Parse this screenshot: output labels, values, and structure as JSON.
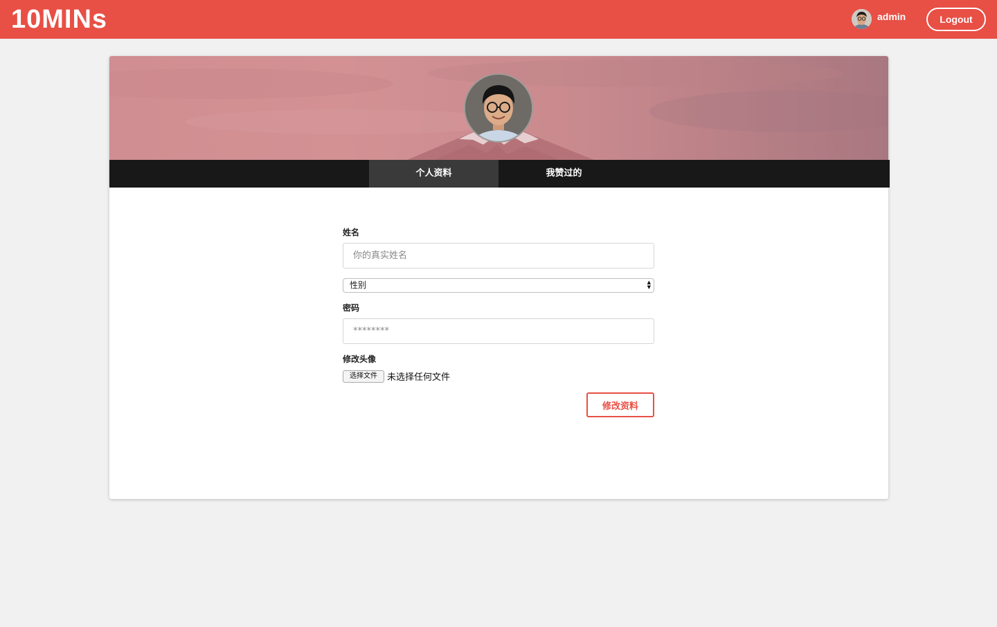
{
  "header": {
    "brand": "10MINs",
    "username": "admin",
    "logout_label": "Logout"
  },
  "profile": {
    "tabs": [
      {
        "label": "个人资料",
        "active": true
      },
      {
        "label": "我赞过的",
        "active": false
      }
    ]
  },
  "form": {
    "name_label": "姓名",
    "name_placeholder": "你的真实姓名",
    "gender_selected": "性别",
    "password_label": "密码",
    "password_value": "********",
    "avatar_label": "修改头像",
    "file_button_label": "选择文件",
    "file_status": "未选择任何文件",
    "submit_label": "修改资料"
  },
  "colors": {
    "brand_red": "#e84f45",
    "tab_bar": "#181818",
    "tab_active": "#3a3a3a",
    "page_bg": "#f1f1f1"
  }
}
